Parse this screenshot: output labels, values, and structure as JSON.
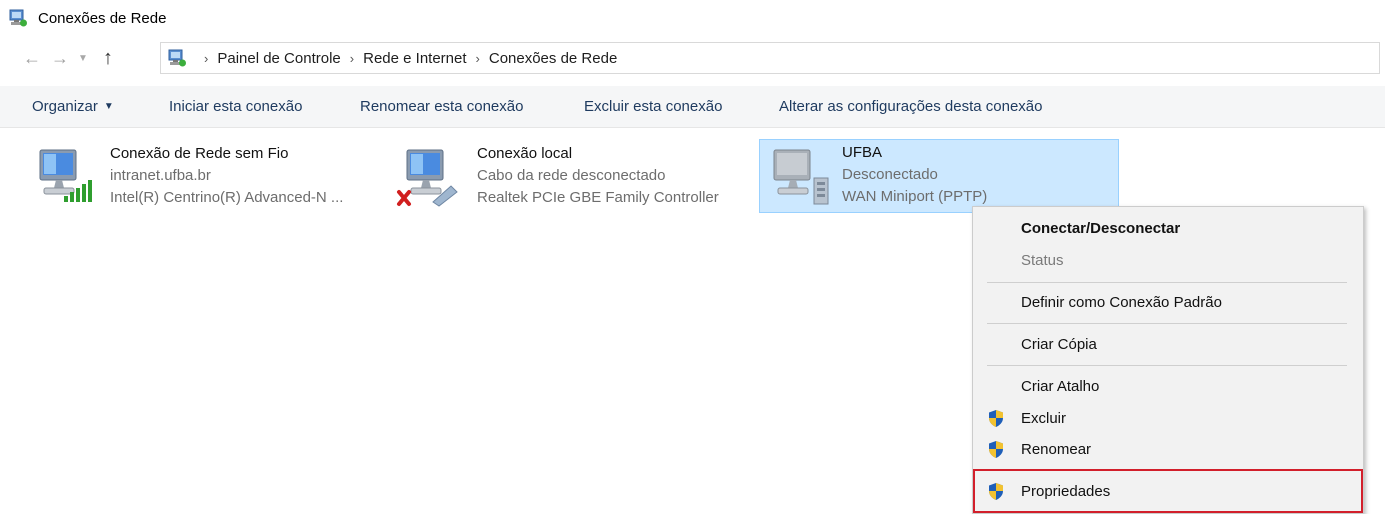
{
  "window": {
    "title": "Conexões de Rede"
  },
  "breadcrumb": [
    "Painel de Controle",
    "Rede e Internet",
    "Conexões de Rede"
  ],
  "commands": {
    "organize": "Organizar",
    "start": "Iniciar esta conexão",
    "rename": "Renomear esta conexão",
    "delete": "Excluir esta conexão",
    "change": "Alterar as configurações desta conexão"
  },
  "connections": [
    {
      "name": "Conexão de Rede sem Fio",
      "status": "intranet.ufba.br",
      "device": "Intel(R) Centrino(R) Advanced-N ..."
    },
    {
      "name": "Conexão local",
      "status": "Cabo da rede desconectado",
      "device": "Realtek PCIe GBE Family Controller"
    },
    {
      "name": "UFBA",
      "status": "Desconectado",
      "device": "WAN Miniport (PPTP)"
    }
  ],
  "context_menu": {
    "connect": "Conectar/Desconectar",
    "status": "Status",
    "default": "Definir como Conexão Padrão",
    "copy": "Criar Cópia",
    "shortcut": "Criar Atalho",
    "delete": "Excluir",
    "rename": "Renomear",
    "properties": "Propriedades"
  },
  "icons": {
    "back": "arrow-left-icon",
    "forward": "arrow-right-icon",
    "recent": "chevron-down-icon",
    "up": "arrow-up-icon",
    "shield": "uac-shield-icon"
  },
  "colors": {
    "selection_bg": "#cce8ff",
    "selection_border": "#99d1ff",
    "highlight_border": "#d21f2b",
    "menu_bg": "#f2f2f2"
  }
}
